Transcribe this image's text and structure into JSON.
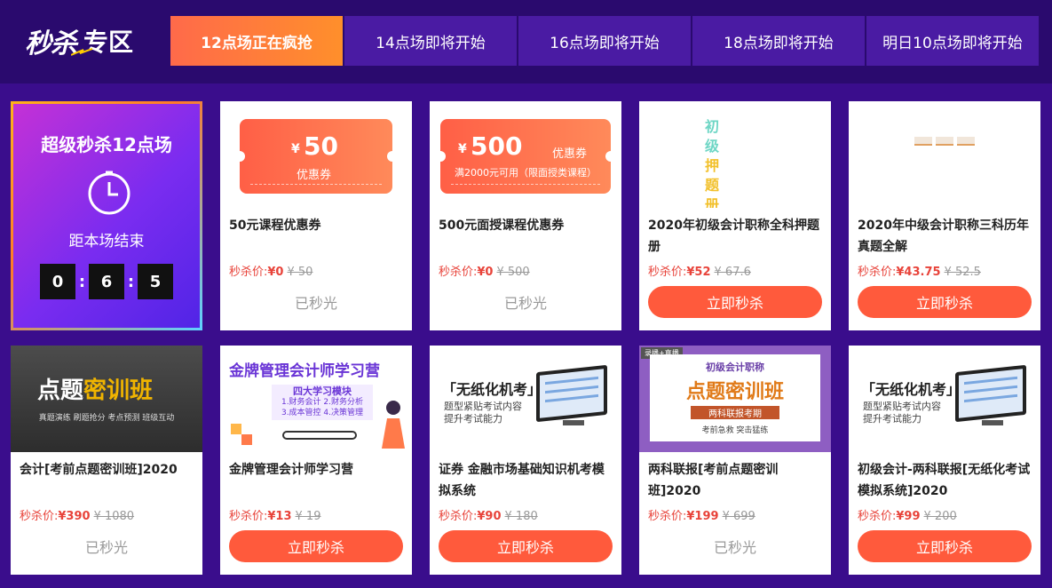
{
  "header": {
    "logo_part1": "秒杀",
    "logo_part2": "专区",
    "tabs": [
      {
        "label": "12点场正在疯抢",
        "active": true
      },
      {
        "label": "14点场即将开始",
        "active": false
      },
      {
        "label": "16点场即将开始",
        "active": false
      },
      {
        "label": "18点场即将开始",
        "active": false
      },
      {
        "label": "明日10点场即将开始",
        "active": false
      }
    ]
  },
  "countdown": {
    "title": "超级秒杀12点场",
    "label": "距本场结束",
    "digits": [
      "0",
      "6",
      "5"
    ],
    "colons": [
      ":",
      ":"
    ]
  },
  "products": [
    {
      "title": "50元课程优惠券",
      "price_label": "秒杀价:",
      "price": "¥0",
      "original": "¥ 50",
      "status": "已秒光",
      "thumb": {
        "currency": "¥",
        "amount": "50",
        "sub": "优惠券"
      }
    },
    {
      "title": "500元面授课程优惠券",
      "price_label": "秒杀价:",
      "price": "¥0",
      "original": "¥ 500",
      "status": "已秒光",
      "thumb": {
        "currency": "¥",
        "amount": "500",
        "unit": "优惠券",
        "sub": "满2000元可用（限面授类课程）"
      }
    },
    {
      "title": "2020年初级会计职称全科押题册",
      "price_label": "秒杀价:",
      "price": "¥52",
      "original": "¥ 67.6",
      "button": "立即秒杀",
      "thumb": {
        "vertical": [
          "初",
          "级",
          "押",
          "题",
          "册"
        ]
      }
    },
    {
      "title": "2020年中级会计职称三科历年真题全解",
      "price_label": "秒杀价:",
      "price": "¥43.75",
      "original": "¥ 52.5",
      "button": "立即秒杀"
    },
    {
      "title": "会计[考前点题密训班]2020",
      "price_label": "秒杀价:",
      "price": "¥390",
      "original": "¥ 1080",
      "status": "已秒光",
      "thumb": {
        "big_a": "点题",
        "big_b": "密训班",
        "small": "真题演练  刷题抢分  考点预测  班级互动"
      }
    },
    {
      "title": "金牌管理会计师学习营",
      "price_label": "秒杀价:",
      "price": "¥13",
      "original": "¥ 19",
      "button": "立即秒杀",
      "thumb": {
        "title": "金牌管理会计师学习营",
        "box_title": "四大学习模块",
        "box_lines": [
          "1.财务会计  2.财务分析",
          "3.成本管控  4.决策管理"
        ]
      }
    },
    {
      "title": "证券 金融市场基础知识机考模拟系统",
      "price_label": "秒杀价:",
      "price": "¥90",
      "original": "¥ 180",
      "button": "立即秒杀",
      "thumb": {
        "title": "「无纸化机考」",
        "sub1": "题型紧贴考试内容",
        "sub2": "提升考试能力"
      }
    },
    {
      "title": "两科联报[考前点题密训班]2020",
      "price_label": "秒杀价:",
      "price": "¥199",
      "original": "¥ 699",
      "status": "已秒光",
      "thumb": {
        "tag": "录播+直播",
        "t1": "初级会计职称",
        "t2": "点题密训班",
        "t3": "两科联报考期",
        "t4": "考前急救    突击猛练"
      }
    },
    {
      "title": "初级会计-两科联报[无纸化考试模拟系统]2020",
      "price_label": "秒杀价:",
      "price": "¥99",
      "original": "¥ 200",
      "button": "立即秒杀",
      "thumb": {
        "title": "「无纸化机考」",
        "sub1": "题型紧贴考试内容",
        "sub2": "提升考试能力"
      }
    }
  ]
}
